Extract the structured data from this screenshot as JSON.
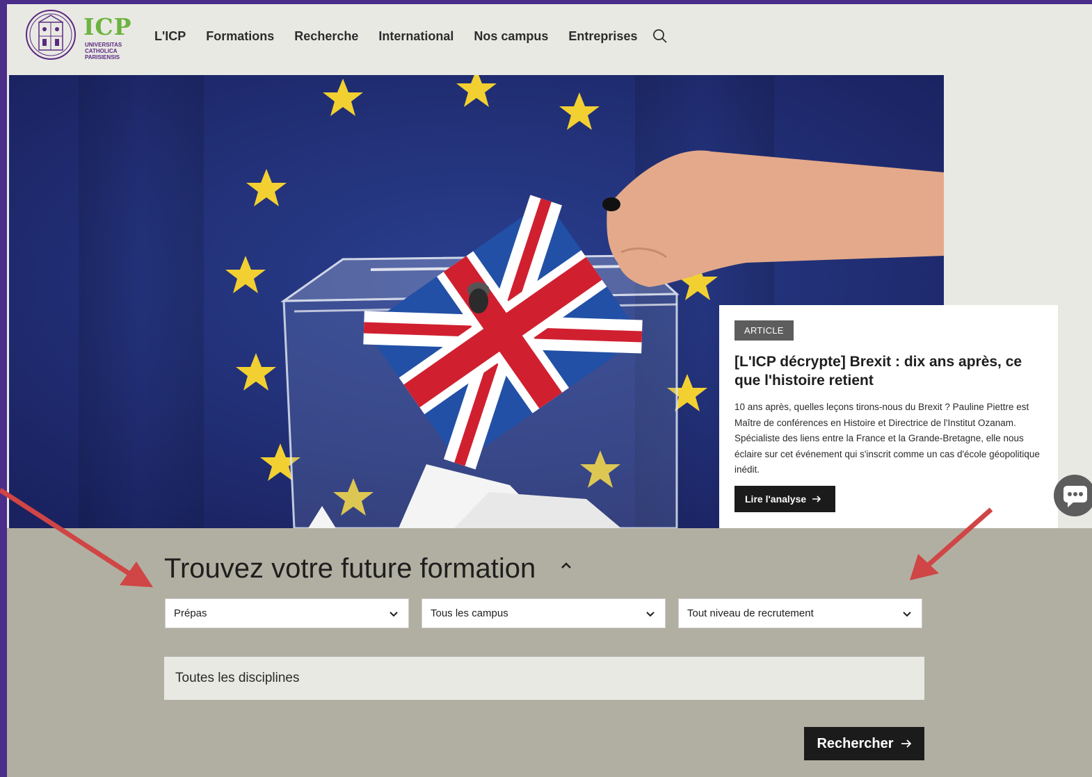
{
  "logo": {
    "wordmark": "ICP",
    "subtitle": [
      "Universitas",
      "Catholica",
      "Parisiensis"
    ]
  },
  "nav": {
    "items": [
      "L'ICP",
      "Formations",
      "Recherche",
      "International",
      "Nos campus",
      "Entreprises"
    ]
  },
  "article": {
    "badge": "ARTICLE",
    "title": "[L'ICP décrypte] Brexit : dix ans après, ce que l'histoire retient",
    "text": "10 ans après, quelles leçons tirons-nous du Brexit ? Pauline Piettre est Maître de conférences en Histoire et Directrice de l'Institut Ozanam. Spécialiste des liens entre la France et la Grande-Bretagne, elle nous éclaire sur cet événement qui s'inscrit comme un cas d'école géopolitique inédit.",
    "cta": "Lire l'analyse"
  },
  "search": {
    "title": "Trouvez votre future formation",
    "type_select": "Prépas",
    "campus_select": "Tous les campus",
    "level_select": "Tout niveau de recrutement",
    "discipline_field": "Toutes les disciplines",
    "submit": "Rechercher"
  },
  "colors": {
    "page_border": "#4b2d8a",
    "logo_green": "#6cb33f",
    "logo_purple": "#5a2a82",
    "section_bg": "#b1afa1",
    "button_dark": "#1b1b1b",
    "annotation_arrow": "#d04545"
  }
}
